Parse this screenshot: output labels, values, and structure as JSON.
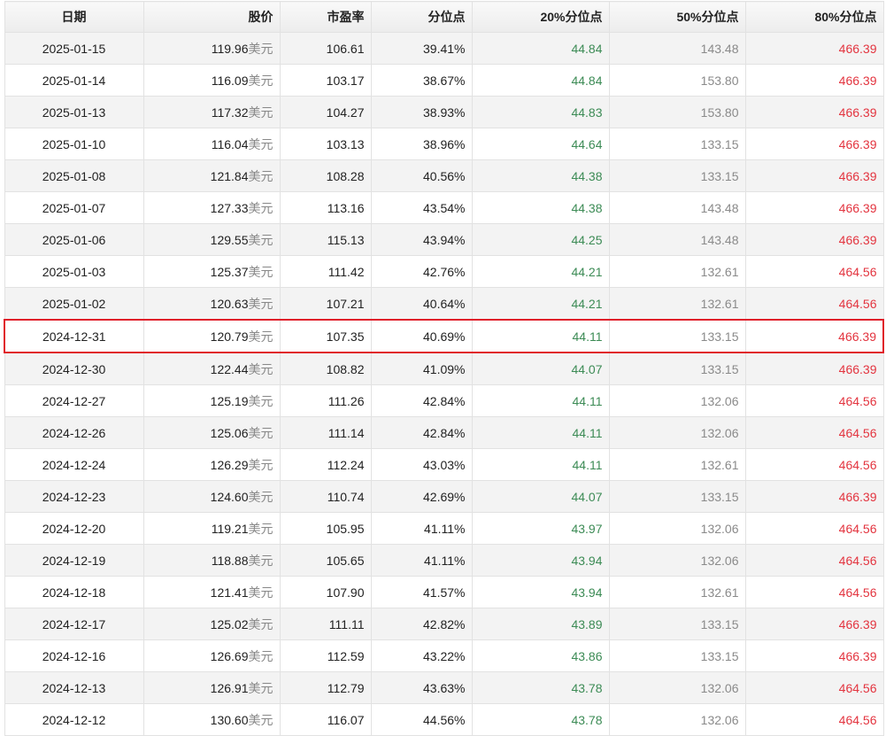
{
  "highlight_color": "#e0202a",
  "columns": [
    "日期",
    "股价",
    "市盈率",
    "分位点",
    "20%分位点",
    "50%分位点",
    "80%分位点"
  ],
  "currency_unit": "美元",
  "highlighted_date": "2024-12-31",
  "rows": [
    {
      "date": "2025-01-15",
      "price": "119.96",
      "pe": "106.61",
      "pct": "39.41%",
      "p20": "44.84",
      "p50": "143.48",
      "p80": "466.39"
    },
    {
      "date": "2025-01-14",
      "price": "116.09",
      "pe": "103.17",
      "pct": "38.67%",
      "p20": "44.84",
      "p50": "153.80",
      "p80": "466.39"
    },
    {
      "date": "2025-01-13",
      "price": "117.32",
      "pe": "104.27",
      "pct": "38.93%",
      "p20": "44.83",
      "p50": "153.80",
      "p80": "466.39"
    },
    {
      "date": "2025-01-10",
      "price": "116.04",
      "pe": "103.13",
      "pct": "38.96%",
      "p20": "44.64",
      "p50": "133.15",
      "p80": "466.39"
    },
    {
      "date": "2025-01-08",
      "price": "121.84",
      "pe": "108.28",
      "pct": "40.56%",
      "p20": "44.38",
      "p50": "133.15",
      "p80": "466.39"
    },
    {
      "date": "2025-01-07",
      "price": "127.33",
      "pe": "113.16",
      "pct": "43.54%",
      "p20": "44.38",
      "p50": "143.48",
      "p80": "466.39"
    },
    {
      "date": "2025-01-06",
      "price": "129.55",
      "pe": "115.13",
      "pct": "43.94%",
      "p20": "44.25",
      "p50": "143.48",
      "p80": "466.39"
    },
    {
      "date": "2025-01-03",
      "price": "125.37",
      "pe": "111.42",
      "pct": "42.76%",
      "p20": "44.21",
      "p50": "132.61",
      "p80": "464.56"
    },
    {
      "date": "2025-01-02",
      "price": "120.63",
      "pe": "107.21",
      "pct": "40.64%",
      "p20": "44.21",
      "p50": "132.61",
      "p80": "464.56"
    },
    {
      "date": "2024-12-31",
      "price": "120.79",
      "pe": "107.35",
      "pct": "40.69%",
      "p20": "44.11",
      "p50": "133.15",
      "p80": "466.39"
    },
    {
      "date": "2024-12-30",
      "price": "122.44",
      "pe": "108.82",
      "pct": "41.09%",
      "p20": "44.07",
      "p50": "133.15",
      "p80": "466.39"
    },
    {
      "date": "2024-12-27",
      "price": "125.19",
      "pe": "111.26",
      "pct": "42.84%",
      "p20": "44.11",
      "p50": "132.06",
      "p80": "464.56"
    },
    {
      "date": "2024-12-26",
      "price": "125.06",
      "pe": "111.14",
      "pct": "42.84%",
      "p20": "44.11",
      "p50": "132.06",
      "p80": "464.56"
    },
    {
      "date": "2024-12-24",
      "price": "126.29",
      "pe": "112.24",
      "pct": "43.03%",
      "p20": "44.11",
      "p50": "132.61",
      "p80": "464.56"
    },
    {
      "date": "2024-12-23",
      "price": "124.60",
      "pe": "110.74",
      "pct": "42.69%",
      "p20": "44.07",
      "p50": "133.15",
      "p80": "466.39"
    },
    {
      "date": "2024-12-20",
      "price": "119.21",
      "pe": "105.95",
      "pct": "41.11%",
      "p20": "43.97",
      "p50": "132.06",
      "p80": "464.56"
    },
    {
      "date": "2024-12-19",
      "price": "118.88",
      "pe": "105.65",
      "pct": "41.11%",
      "p20": "43.94",
      "p50": "132.06",
      "p80": "464.56"
    },
    {
      "date": "2024-12-18",
      "price": "121.41",
      "pe": "107.90",
      "pct": "41.57%",
      "p20": "43.94",
      "p50": "132.61",
      "p80": "464.56"
    },
    {
      "date": "2024-12-17",
      "price": "125.02",
      "pe": "111.11",
      "pct": "42.82%",
      "p20": "43.89",
      "p50": "133.15",
      "p80": "466.39"
    },
    {
      "date": "2024-12-16",
      "price": "126.69",
      "pe": "112.59",
      "pct": "43.22%",
      "p20": "43.86",
      "p50": "133.15",
      "p80": "466.39"
    },
    {
      "date": "2024-12-13",
      "price": "126.91",
      "pe": "112.79",
      "pct": "43.63%",
      "p20": "43.78",
      "p50": "132.06",
      "p80": "464.56"
    },
    {
      "date": "2024-12-12",
      "price": "130.60",
      "pe": "116.07",
      "pct": "44.56%",
      "p20": "43.78",
      "p50": "132.06",
      "p80": "464.56"
    }
  ]
}
